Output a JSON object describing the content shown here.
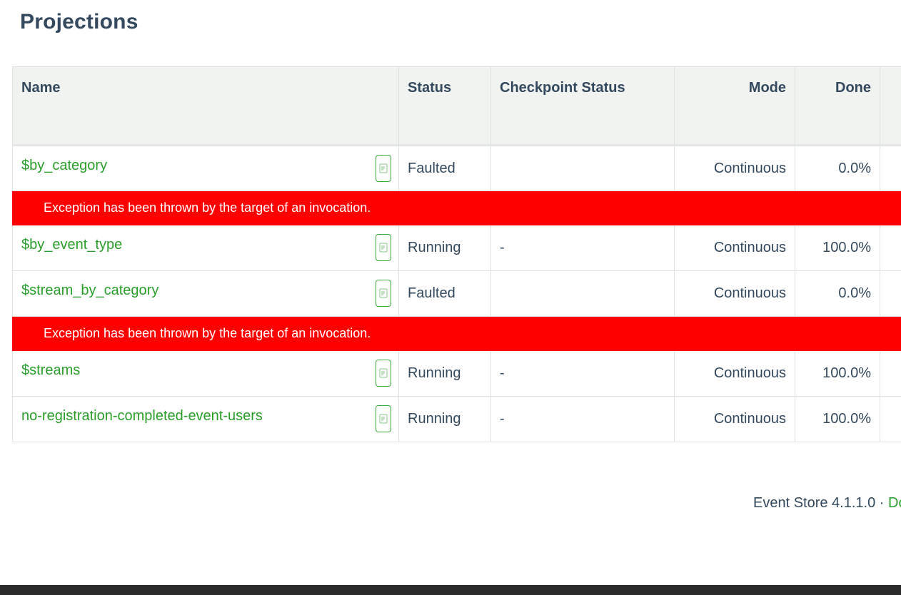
{
  "page": {
    "title": "Projections"
  },
  "table": {
    "columns": {
      "name": "Name",
      "status": "Status",
      "checkpoint": "Checkpoint Status",
      "mode": "Mode",
      "done": "Done"
    },
    "rows": [
      {
        "name": "$by_category",
        "status": "Faulted",
        "checkpoint": "",
        "mode": "Continuous",
        "done": "0.0%",
        "error": "Exception has been thrown by the target of an invocation."
      },
      {
        "name": "$by_event_type",
        "status": "Running",
        "checkpoint": "-",
        "mode": "Continuous",
        "done": "100.0%"
      },
      {
        "name": "$stream_by_category",
        "status": "Faulted",
        "checkpoint": "",
        "mode": "Continuous",
        "done": "0.0%",
        "error": "Exception has been thrown by the target of an invocation."
      },
      {
        "name": "$streams",
        "status": "Running",
        "checkpoint": "-",
        "mode": "Continuous",
        "done": "100.0%"
      },
      {
        "name": "no-registration-completed-event-users",
        "status": "Running",
        "checkpoint": "-",
        "mode": "Continuous",
        "done": "100.0%"
      }
    ]
  },
  "footer": {
    "version_text": "Event Store 4.1.1.0 · ",
    "link_text": "Do"
  },
  "icons": {
    "edit": "edit-query-icon"
  },
  "colors": {
    "link": "#2a9d2a",
    "error_bg": "#ff0000",
    "header_bg": "#f1f3f0",
    "title": "#34495e"
  }
}
